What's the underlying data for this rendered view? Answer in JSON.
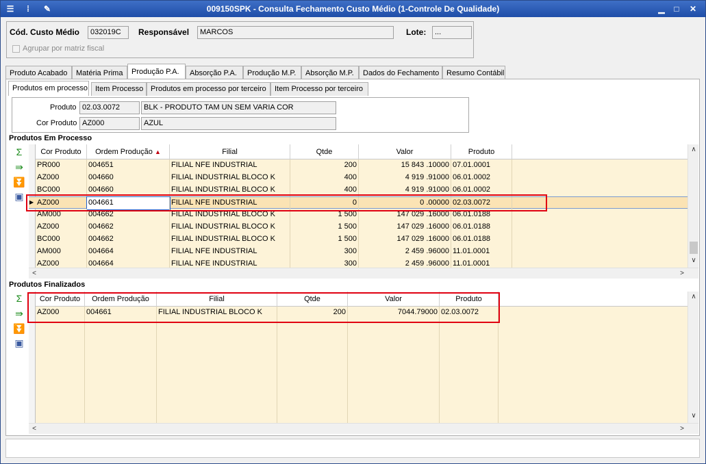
{
  "window": {
    "title": "009150SPK - Consulta Fechamento Custo Médio (1-Controle De Qualidade)"
  },
  "header": {
    "cod_label": "Cód. Custo Médio",
    "cod_value": "032019C",
    "resp_label": "Responsável",
    "resp_value": "MARCOS",
    "lote_label": "Lote:",
    "lote_value": "...",
    "agrupar_label": "Agrupar por matriz fiscal"
  },
  "tabs": [
    "Produto Acabado",
    "Matéria Prima",
    "Produção P.A.",
    "Absorção P.A.",
    "Produção M.P.",
    "Absorção M.P.",
    "Dados do Fechamento",
    "Resumo Contábil"
  ],
  "subtabs": [
    "Produtos em processo",
    "Item Processo",
    "Produtos em processo por terceiro",
    "Item Processo por terceiro"
  ],
  "info": {
    "produto_label": "Produto",
    "produto_code": "02.03.0072",
    "produto_desc": "BLK - PRODUTO TAM UN SEM VARIA COR",
    "cor_label": "Cor Produto",
    "cor_code": "AZ000",
    "cor_desc": "AZUL"
  },
  "em_processo": {
    "title": "Produtos Em Processo",
    "columns": [
      "Cor Produto",
      "Ordem Produção",
      "Filial",
      "Qtde",
      "Valor",
      "Produto"
    ],
    "sort_indicator": "▲",
    "rows": [
      [
        "PR000",
        "004651",
        "FILIAL NFE INDUSTRIAL",
        "200",
        "15 843 .10000",
        "07.01.0001"
      ],
      [
        "AZ000",
        "004660",
        "FILIAL INDUSTRIAL BLOCO K",
        "400",
        "4 919 .91000",
        "06.01.0002"
      ],
      [
        "BC000",
        "004660",
        "FILIAL INDUSTRIAL BLOCO K",
        "400",
        "4 919 .91000",
        "06.01.0002"
      ],
      [
        "AZ000",
        "004661",
        "FILIAL NFE INDUSTRIAL",
        "0",
        "0 .00000",
        "02.03.0072"
      ],
      [
        "AM000",
        "004662",
        "FILIAL INDUSTRIAL BLOCO K",
        "1 500",
        "147 029 .16000",
        "06.01.0188"
      ],
      [
        "AZ000",
        "004662",
        "FILIAL INDUSTRIAL BLOCO K",
        "1 500",
        "147 029 .16000",
        "06.01.0188"
      ],
      [
        "BC000",
        "004662",
        "FILIAL INDUSTRIAL BLOCO K",
        "1 500",
        "147 029 .16000",
        "06.01.0188"
      ],
      [
        "AM000",
        "004664",
        "FILIAL NFE INDUSTRIAL",
        "300",
        "2 459 .96000",
        "11.01.0001"
      ],
      [
        "AZ000",
        "004664",
        "FILIAL NFE INDUSTRIAL",
        "300",
        "2 459 .96000",
        "11.01.0001"
      ]
    ]
  },
  "finalizados": {
    "title": "Produtos Finalizados",
    "columns": [
      "Cor Produto",
      "Ordem Produção",
      "Filial",
      "Qtde",
      "Valor",
      "Produto"
    ],
    "rows": [
      [
        "AZ000",
        "004661",
        "FILIAL INDUSTRIAL BLOCO K",
        "200",
        "7044.79000",
        "02.03.0072"
      ]
    ]
  },
  "icons": {
    "sum": "sigma-icon",
    "export": "export-icon",
    "filter": "filter-icon",
    "image": "image-icon"
  }
}
